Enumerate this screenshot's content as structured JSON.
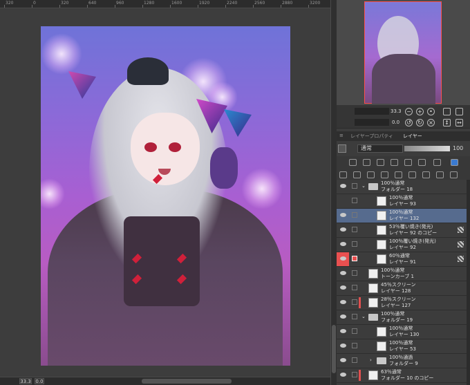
{
  "ruler": {
    "ticks": [
      "320",
      "0",
      "320",
      "640",
      "960",
      "1280",
      "1600",
      "1920",
      "2240",
      "2560",
      "2880",
      "3200"
    ]
  },
  "status": {
    "zoom": "33.3",
    "angle": "0.0"
  },
  "navigator": {
    "zoom": "33.3",
    "rotation": "0.0"
  },
  "panel_tabs": {
    "layer_property": "レイヤープロパティ",
    "layer": "レイヤー"
  },
  "blend": {
    "mode": "通常",
    "opacity": "100"
  },
  "layers": [
    {
      "kind": "folder",
      "indent": 0,
      "mode": "100％通常",
      "name": "フォルダー 18",
      "visible": true
    },
    {
      "kind": "layer",
      "indent": 1,
      "mode": "100％通常",
      "name": "レイヤー 93",
      "visible": false
    },
    {
      "kind": "layer",
      "indent": 1,
      "mode": "100％通常",
      "name": "レイヤー 132",
      "visible": true,
      "selected": true
    },
    {
      "kind": "layer",
      "indent": 1,
      "mode": "53％覆い焼き(発光)",
      "name": "レイヤー 92 のコピー",
      "visible": true
    },
    {
      "kind": "layer",
      "indent": 1,
      "mode": "100％覆い焼き(発光)",
      "name": "レイヤー 92",
      "visible": true
    },
    {
      "kind": "layer",
      "indent": 1,
      "mode": "60％通常",
      "name": "レイヤー 91",
      "visible": true,
      "red": true
    },
    {
      "kind": "layer",
      "indent": 0,
      "mode": "100％通常",
      "name": "トーンカーブ 1",
      "visible": true
    },
    {
      "kind": "layer",
      "indent": 0,
      "mode": "45％スクリーン",
      "name": "レイヤー 128",
      "visible": true
    },
    {
      "kind": "layer",
      "indent": 0,
      "mode": "28％スクリーン",
      "name": "レイヤー 127",
      "visible": true
    },
    {
      "kind": "folder",
      "indent": 0,
      "mode": "100％通常",
      "name": "フォルダー 19",
      "visible": true
    },
    {
      "kind": "layer",
      "indent": 1,
      "mode": "100％通常",
      "name": "レイヤー 130",
      "visible": true
    },
    {
      "kind": "layer",
      "indent": 1,
      "mode": "100％通常",
      "name": "レイヤー 53",
      "visible": true
    },
    {
      "kind": "folder",
      "indent": 1,
      "mode": "100％通過",
      "name": "フォルダー 9",
      "visible": true
    },
    {
      "kind": "layer",
      "indent": 0,
      "mode": "63％通常",
      "name": "フォルダー 10 のコピー",
      "visible": true
    }
  ]
}
